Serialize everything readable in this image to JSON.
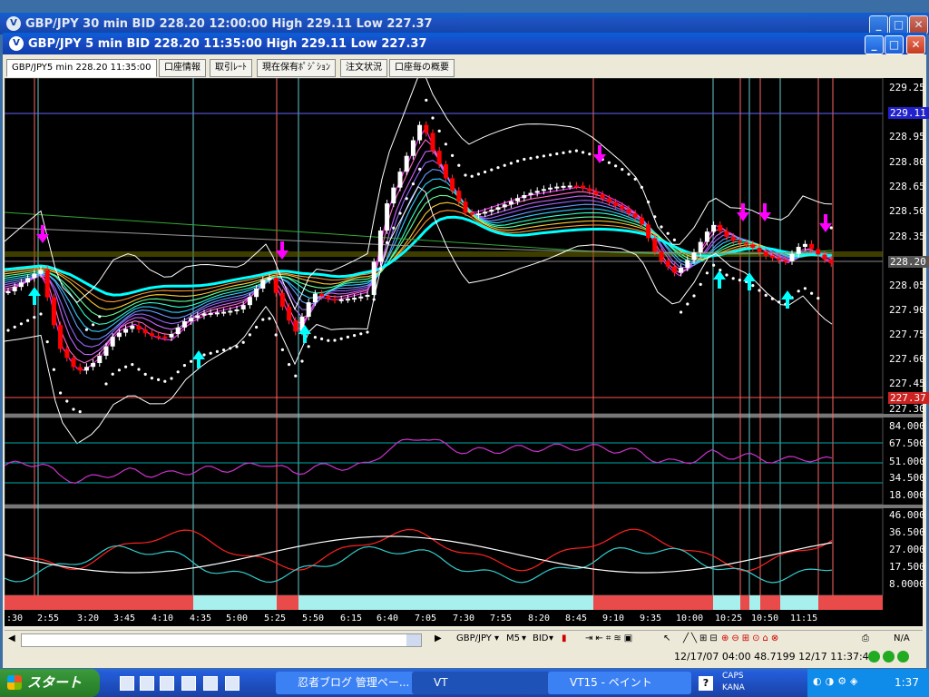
{
  "back_window": {
    "title": "GBP/JPY 30 min BID 228.20 12:00:00 High 229.11 Low 227.37"
  },
  "window": {
    "title": "GBP/JPY 5 min BID 228.20 11:35:00 High 229.11 Low 227.37",
    "minimize": "_",
    "maximize": "□",
    "close": "✕"
  },
  "tabs": [
    {
      "label": "GBP/JPY5 min 228.20 11:35:00"
    },
    {
      "label": "口座情報"
    },
    {
      "label": "取引ﾚｰﾄ"
    },
    {
      "label": "現在保有ﾎﾟｼﾞｼｮﾝ"
    },
    {
      "label": "注文状況"
    },
    {
      "label": "口座毎の概要"
    }
  ],
  "price_axis": [
    "229.25",
    "228.95",
    "228.80",
    "228.65",
    "228.50",
    "228.35",
    "228.05",
    "227.90",
    "227.75",
    "227.60",
    "227.45",
    "227.30"
  ],
  "price_tags": {
    "high": "229.11",
    "current": "228.20",
    "low": "227.37"
  },
  "rsi_axis": [
    "84.000",
    "67.500",
    "51.000",
    "34.500",
    "18.000"
  ],
  "dmi_axis": [
    "46.000",
    "36.500",
    "27.000",
    "17.500",
    "8.0000"
  ],
  "time_axis": [
    ":30",
    "2:55",
    "3:20",
    "3:45",
    "4:10",
    "4:35",
    "5:00",
    "5:25",
    "5:50",
    "6:15",
    "6:40",
    "7:05",
    "7:30",
    "7:55",
    "8:20",
    "8:45",
    "9:10",
    "9:35",
    "10:00",
    "10:25",
    "10:50",
    "11:15"
  ],
  "toolbar": {
    "symbol": "GBP/JPY",
    "tf": "M5",
    "side": "BID",
    "na": "N/A"
  },
  "statusbar": {
    "text": "12/17/07 04:00  48.7199  12/17 11:37:42"
  },
  "taskbar": {
    "start": "スタート",
    "items": [
      {
        "label": "忍者ブログ 管理ペー..."
      },
      {
        "label": "VT"
      },
      {
        "label": "VT15 - ペイント"
      }
    ],
    "caps": "CAPS",
    "kana": "KANA",
    "clock": "1:37"
  },
  "colors": {
    "accent_cyan": "#00ffff",
    "arrow_magenta": "#ff00ff",
    "bear_candle": "#ff0000",
    "bull_candle": "#ffffff",
    "strip_red": "#e94b4b",
    "strip_cyan": "#a8f0ee"
  }
}
